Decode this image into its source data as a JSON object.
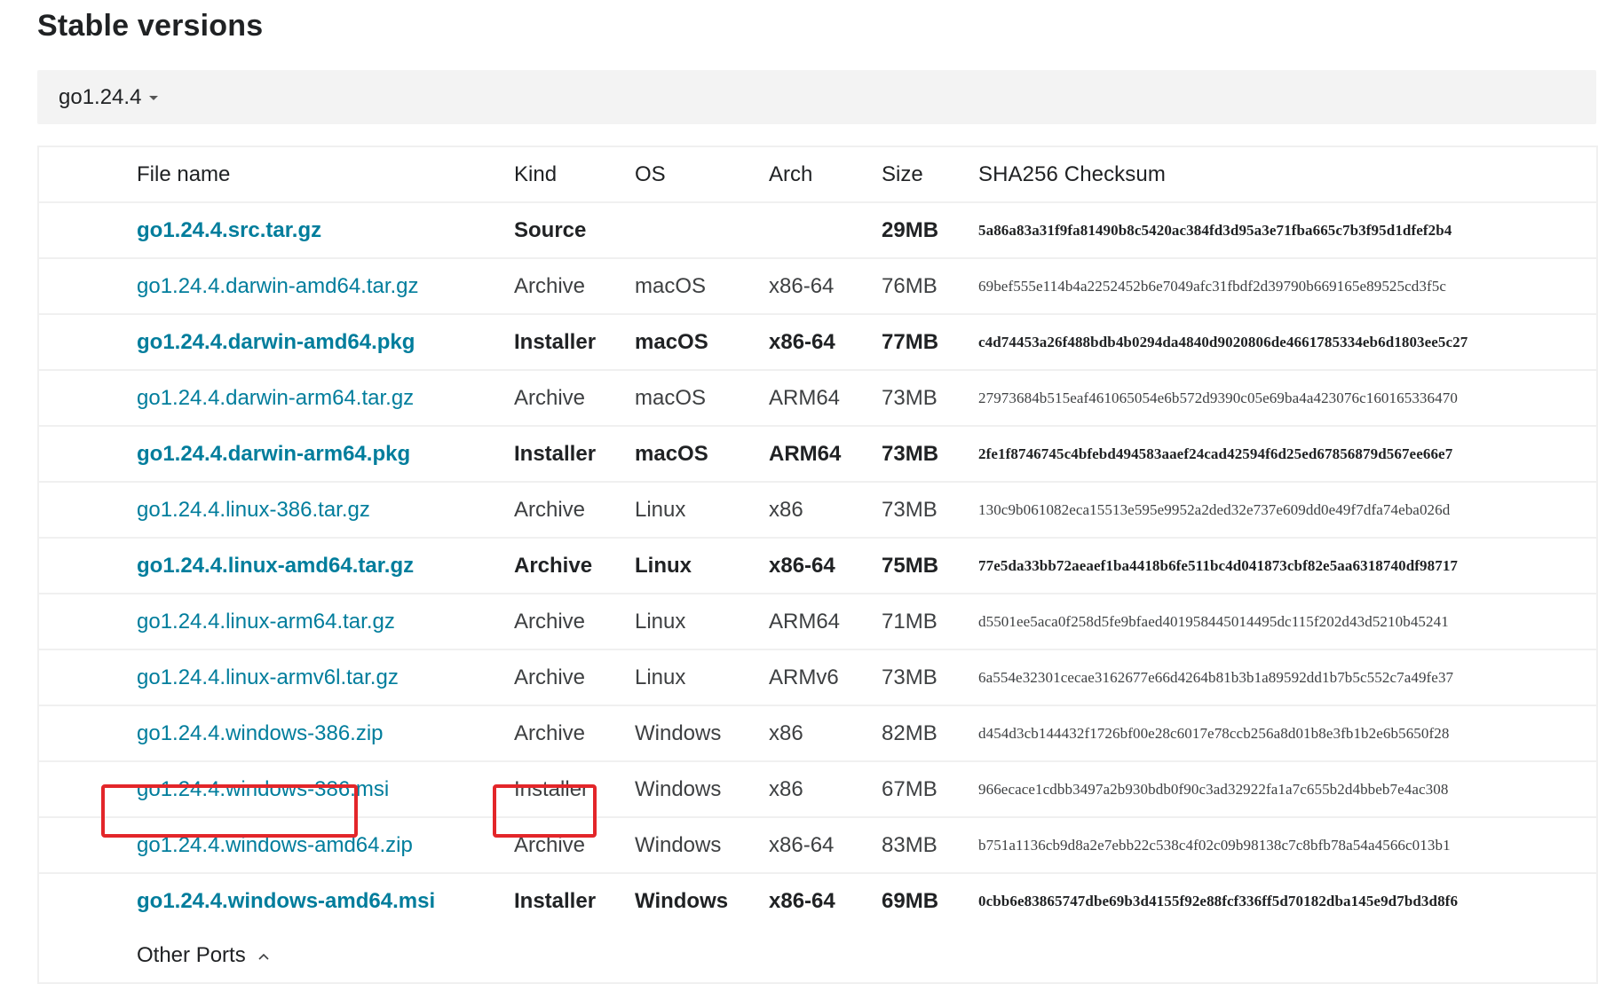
{
  "section": {
    "title": "Stable versions"
  },
  "version_selector": {
    "value": "go1.24.4"
  },
  "table": {
    "headers": {
      "file_name": "File name",
      "kind": "Kind",
      "os": "OS",
      "arch": "Arch",
      "size": "Size",
      "sha": "SHA256 Checksum"
    },
    "rows": [
      {
        "file": "go1.24.4.src.tar.gz",
        "kind": "Source",
        "os": "",
        "arch": "",
        "size": "29MB",
        "sha": "5a86a83a31f9fa81490b8c5420ac384fd3d95a3e71fba665c7b3f95d1dfef2b4",
        "featured": true
      },
      {
        "file": "go1.24.4.darwin-amd64.tar.gz",
        "kind": "Archive",
        "os": "macOS",
        "arch": "x86-64",
        "size": "76MB",
        "sha": "69bef555e114b4a2252452b6e7049afc31fbdf2d39790b669165e89525cd3f5c",
        "featured": false
      },
      {
        "file": "go1.24.4.darwin-amd64.pkg",
        "kind": "Installer",
        "os": "macOS",
        "arch": "x86-64",
        "size": "77MB",
        "sha": "c4d74453a26f488bdb4b0294da4840d9020806de4661785334eb6d1803ee5c27",
        "featured": true
      },
      {
        "file": "go1.24.4.darwin-arm64.tar.gz",
        "kind": "Archive",
        "os": "macOS",
        "arch": "ARM64",
        "size": "73MB",
        "sha": "27973684b515eaf461065054e6b572d9390c05e69ba4a423076c160165336470",
        "featured": false
      },
      {
        "file": "go1.24.4.darwin-arm64.pkg",
        "kind": "Installer",
        "os": "macOS",
        "arch": "ARM64",
        "size": "73MB",
        "sha": "2fe1f8746745c4bfebd494583aaef24cad42594f6d25ed67856879d567ee66e7",
        "featured": true
      },
      {
        "file": "go1.24.4.linux-386.tar.gz",
        "kind": "Archive",
        "os": "Linux",
        "arch": "x86",
        "size": "73MB",
        "sha": "130c9b061082eca15513e595e9952a2ded32e737e609dd0e49f7dfa74eba026d",
        "featured": false
      },
      {
        "file": "go1.24.4.linux-amd64.tar.gz",
        "kind": "Archive",
        "os": "Linux",
        "arch": "x86-64",
        "size": "75MB",
        "sha": "77e5da33bb72aeaef1ba4418b6fe511bc4d041873cbf82e5aa6318740df98717",
        "featured": true
      },
      {
        "file": "go1.24.4.linux-arm64.tar.gz",
        "kind": "Archive",
        "os": "Linux",
        "arch": "ARM64",
        "size": "71MB",
        "sha": "d5501ee5aca0f258d5fe9bfaed401958445014495dc115f202d43d5210b45241",
        "featured": false
      },
      {
        "file": "go1.24.4.linux-armv6l.tar.gz",
        "kind": "Archive",
        "os": "Linux",
        "arch": "ARMv6",
        "size": "73MB",
        "sha": "6a554e32301cecae3162677e66d4264b81b3b1a89592dd1b7b5c552c7a49fe37",
        "featured": false
      },
      {
        "file": "go1.24.4.windows-386.zip",
        "kind": "Archive",
        "os": "Windows",
        "arch": "x86",
        "size": "82MB",
        "sha": "d454d3cb144432f1726bf00e28c6017e78ccb256a8d01b8e3fb1b2e6b5650f28",
        "featured": false
      },
      {
        "file": "go1.24.4.windows-386.msi",
        "kind": "Installer",
        "os": "Windows",
        "arch": "x86",
        "size": "67MB",
        "sha": "966ecace1cdbb3497a2b930bdb0f90c3ad32922fa1a7c655b2d4bbeb7e4ac308",
        "featured": false
      },
      {
        "file": "go1.24.4.windows-amd64.zip",
        "kind": "Archive",
        "os": "Windows",
        "arch": "x86-64",
        "size": "83MB",
        "sha": "b751a1136cb9d8a2e7ebb22c538c4f02c09b98138c7c8bfb78a54a4566c013b1",
        "featured": false
      },
      {
        "file": "go1.24.4.windows-amd64.msi",
        "kind": "Installer",
        "os": "Windows",
        "arch": "x86-64",
        "size": "69MB",
        "sha": "0cbb6e83865747dbe69b3d4155f92e88fcf336ff5d70182dba145e9d7bd3d8f6",
        "featured": true
      }
    ]
  },
  "other_ports": {
    "label": "Other Ports"
  },
  "annotation_color": "#e3262a"
}
